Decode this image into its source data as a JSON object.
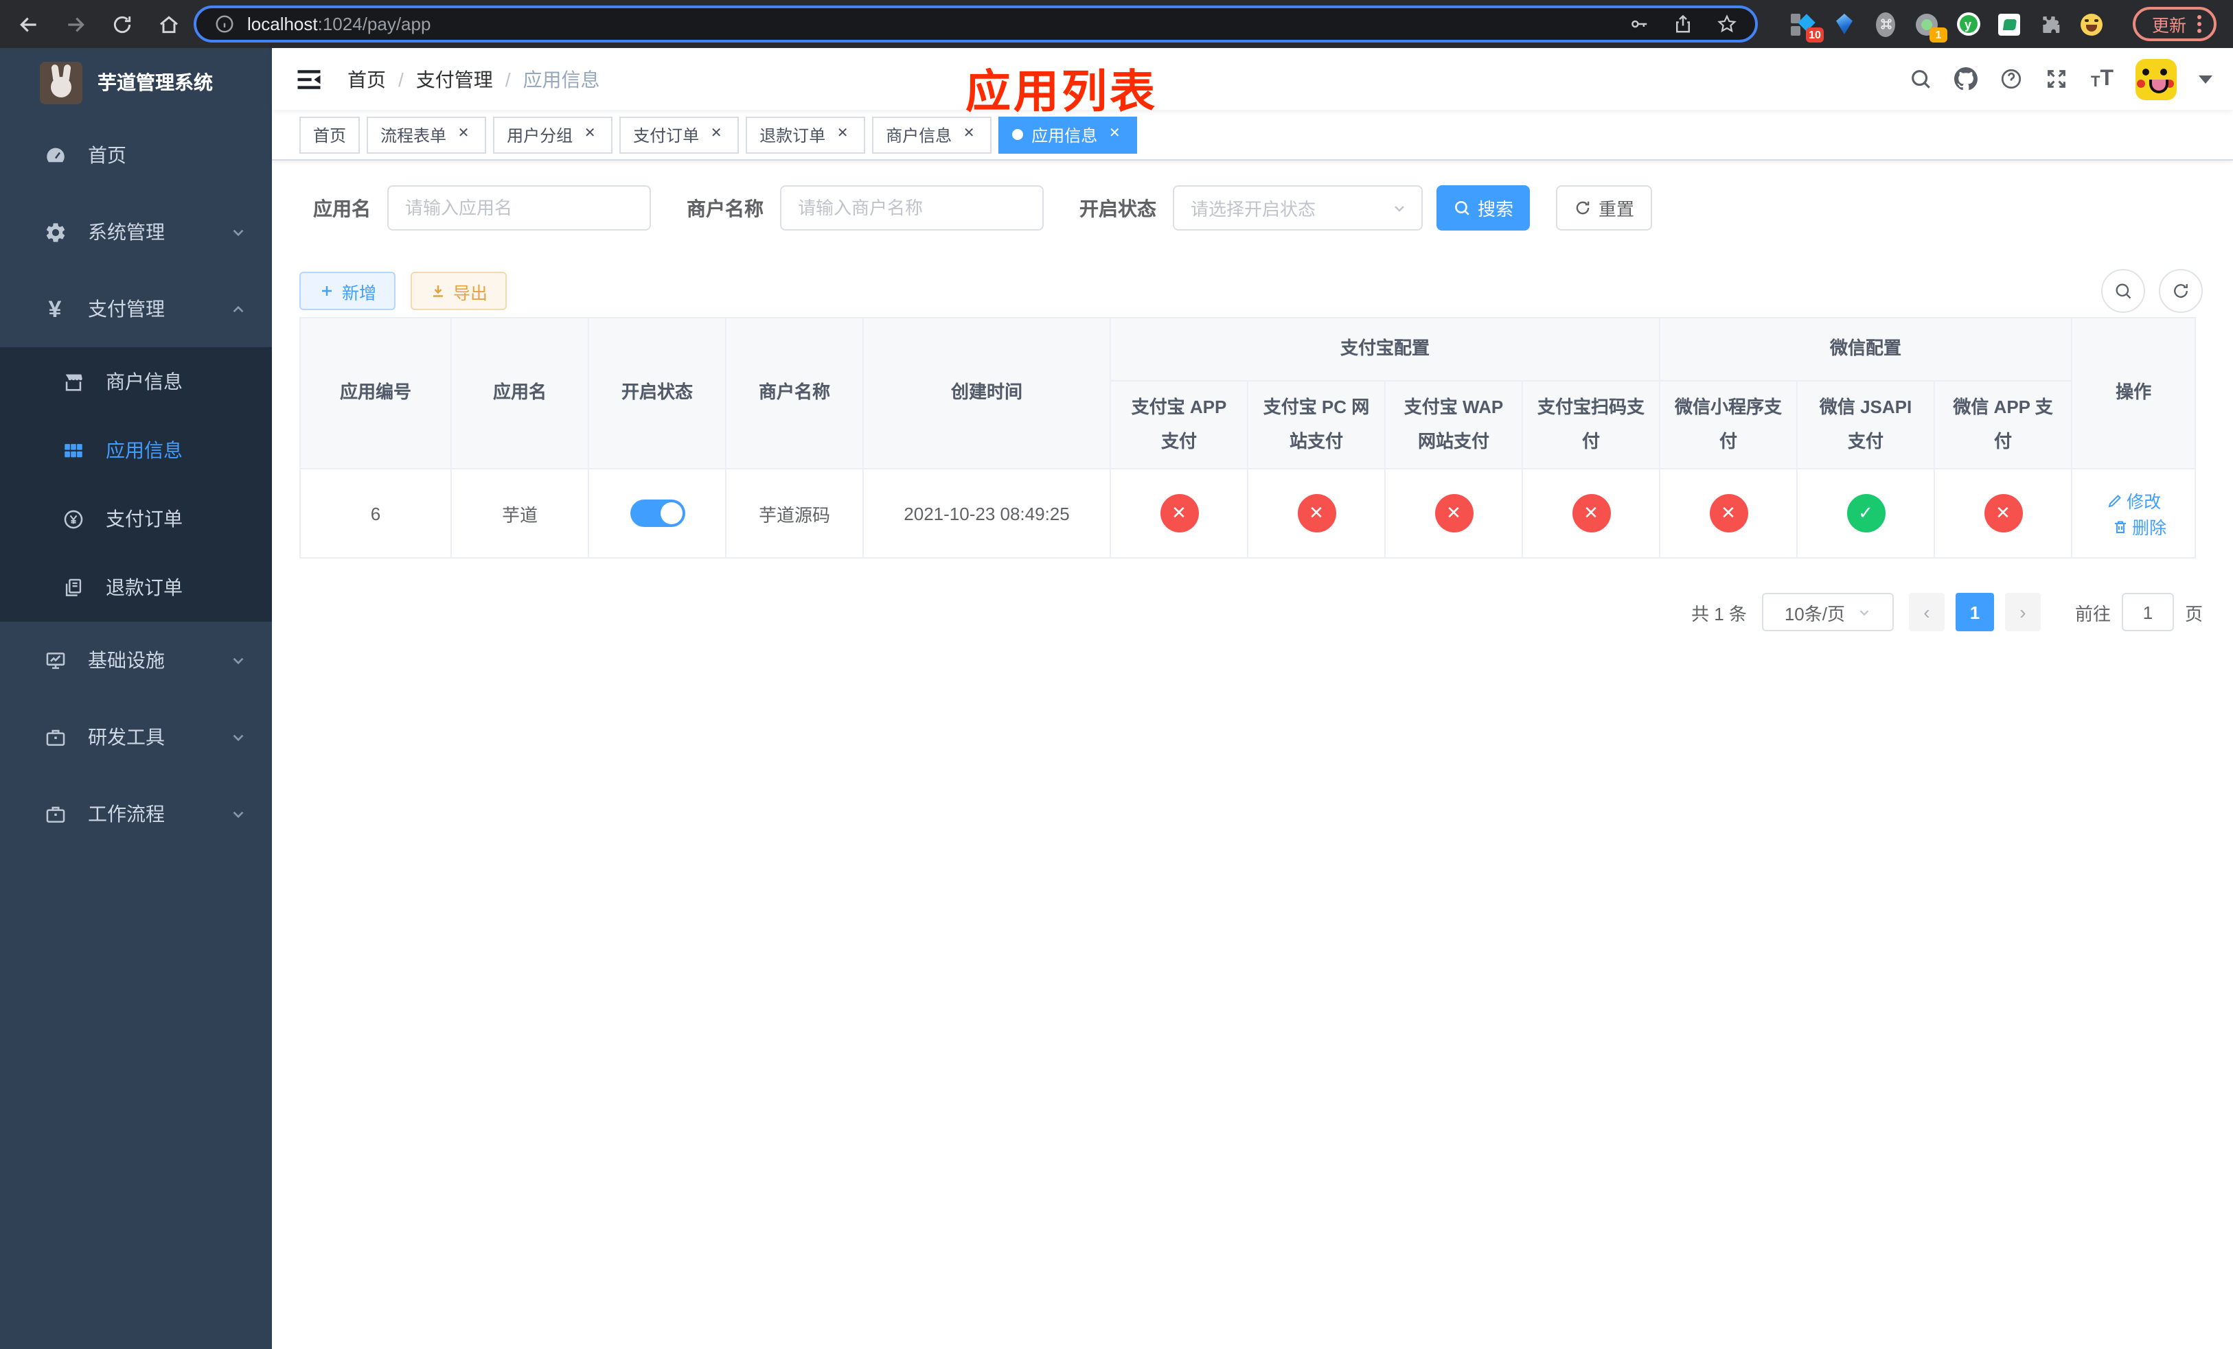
{
  "browser": {
    "url": {
      "host": "localhost",
      "path": ":1024/pay/app"
    },
    "update_button": "更新",
    "extension_badges": {
      "ten": "10",
      "one": "1"
    },
    "y_extension_letter": "y"
  },
  "sidebar": {
    "title": "芋道管理系统",
    "items": [
      {
        "label": "首页"
      },
      {
        "label": "系统管理"
      },
      {
        "label": "支付管理"
      },
      {
        "label": "基础设施"
      },
      {
        "label": "研发工具"
      },
      {
        "label": "工作流程"
      }
    ],
    "submenu": [
      {
        "label": "商户信息"
      },
      {
        "label": "应用信息",
        "active": true
      },
      {
        "label": "支付订单"
      },
      {
        "label": "退款订单"
      }
    ]
  },
  "header": {
    "breadcrumb": [
      "首页",
      "支付管理",
      "应用信息"
    ],
    "annotation": "应用列表"
  },
  "tabs": [
    {
      "label": "首页",
      "closable": false
    },
    {
      "label": "流程表单",
      "closable": true
    },
    {
      "label": "用户分组",
      "closable": true
    },
    {
      "label": "支付订单",
      "closable": true
    },
    {
      "label": "退款订单",
      "closable": true
    },
    {
      "label": "商户信息",
      "closable": true
    },
    {
      "label": "应用信息",
      "closable": true,
      "active": true
    }
  ],
  "filters": {
    "app_name": {
      "label": "应用名",
      "placeholder": "请输入应用名",
      "value": ""
    },
    "merchant_name": {
      "label": "商户名称",
      "placeholder": "请输入商户名称",
      "value": ""
    },
    "status": {
      "label": "开启状态",
      "placeholder": "请选择开启状态",
      "value": ""
    },
    "search_button": "搜索",
    "reset_button": "重置"
  },
  "toolbar": {
    "add_button": "新增",
    "export_button": "导出"
  },
  "table": {
    "groups": {
      "alipay": "支付宝配置",
      "wechat": "微信配置"
    },
    "columns": [
      "应用编号",
      "应用名",
      "开启状态",
      "商户名称",
      "创建时间",
      "支付宝 APP 支付",
      "支付宝 PC 网站支付",
      "支付宝 WAP 网站支付",
      "支付宝扫码支付",
      "微信小程序支付",
      "微信 JSAPI 支付",
      "微信 APP 支付",
      "操作"
    ],
    "row": {
      "id": "6",
      "name": "芋道",
      "enabled": true,
      "merchant": "芋道源码",
      "created_at": "2021-10-23 08:49:25",
      "channels": {
        "alipay_app": "disabled",
        "alipay_pc": "disabled",
        "alipay_wap": "disabled",
        "alipay_qr": "disabled",
        "wechat_lite": "disabled",
        "wechat_jsapi": "enabled",
        "wechat_app": "disabled"
      },
      "actions": {
        "edit": "修改",
        "delete": "删除"
      }
    }
  },
  "pagination": {
    "total": "共 1 条",
    "page_size": "10条/页",
    "page": "1",
    "goto_prefix": "前往",
    "goto_value": "1",
    "goto_suffix": "页"
  },
  "colors": {
    "primary": "#409eff",
    "success": "#1ac96d",
    "danger": "#f7514d",
    "warning": "#e6a23c",
    "sidebar_bg": "#304156",
    "submenu_bg": "#1f2d3d",
    "annotation_red": "#fe2b00"
  }
}
